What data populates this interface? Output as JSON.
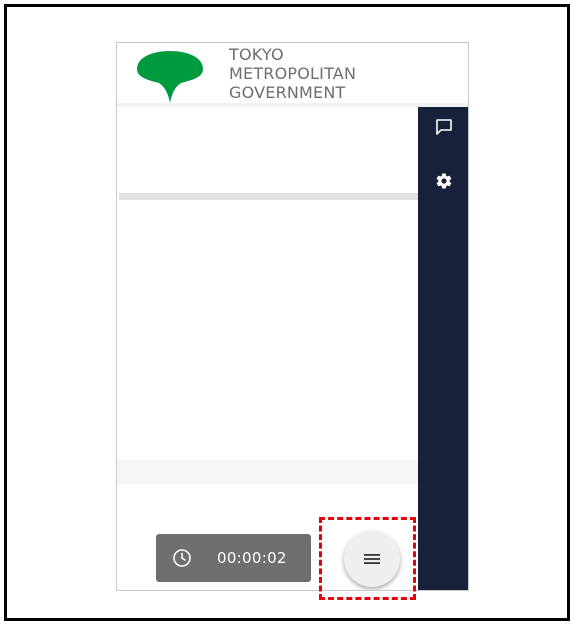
{
  "header": {
    "logo": {
      "line1": "TOKYO",
      "line2": "METROPOLITAN",
      "line3": "GOVERNMENT",
      "leaf_color": "#009a3e",
      "text_color": "#6e6e6e"
    }
  },
  "sidebar": {
    "background": "#17223a",
    "items": [
      {
        "icon": "chat-bubble-icon"
      },
      {
        "icon": "gear-icon"
      }
    ]
  },
  "timer": {
    "icon": "clock-icon",
    "elapsed": "00:00:02"
  },
  "menu_button": {
    "icon": "hamburger-menu-icon"
  },
  "annotation": {
    "highlight_color": "#e8000b",
    "target": "menu-button"
  }
}
